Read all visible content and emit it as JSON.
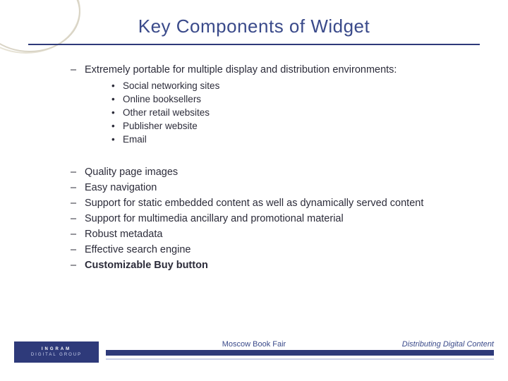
{
  "title": "Key Components of Widget",
  "intro": "Extremely portable for multiple display and distribution environments:",
  "sub_bullets": [
    "Social networking sites",
    "Online booksellers",
    "Other retail websites",
    "Publisher website",
    "Email"
  ],
  "main_bullets": [
    {
      "text": "Quality page images",
      "bold": false
    },
    {
      "text": "Easy navigation",
      "bold": false
    },
    {
      "text": "Support for static embedded content as well as dynamically served content",
      "bold": false
    },
    {
      "text": "Support for multimedia ancillary and promotional material",
      "bold": false
    },
    {
      "text": "Robust metadata",
      "bold": false
    },
    {
      "text": "Effective search engine",
      "bold": false
    },
    {
      "text": "Customizable Buy button",
      "bold": true
    }
  ],
  "logo": {
    "line1": "INGRAM",
    "line2": "DIGITAL GROUP"
  },
  "footer": {
    "center": "Moscow Book Fair",
    "right": "Distributing Digital Content"
  }
}
